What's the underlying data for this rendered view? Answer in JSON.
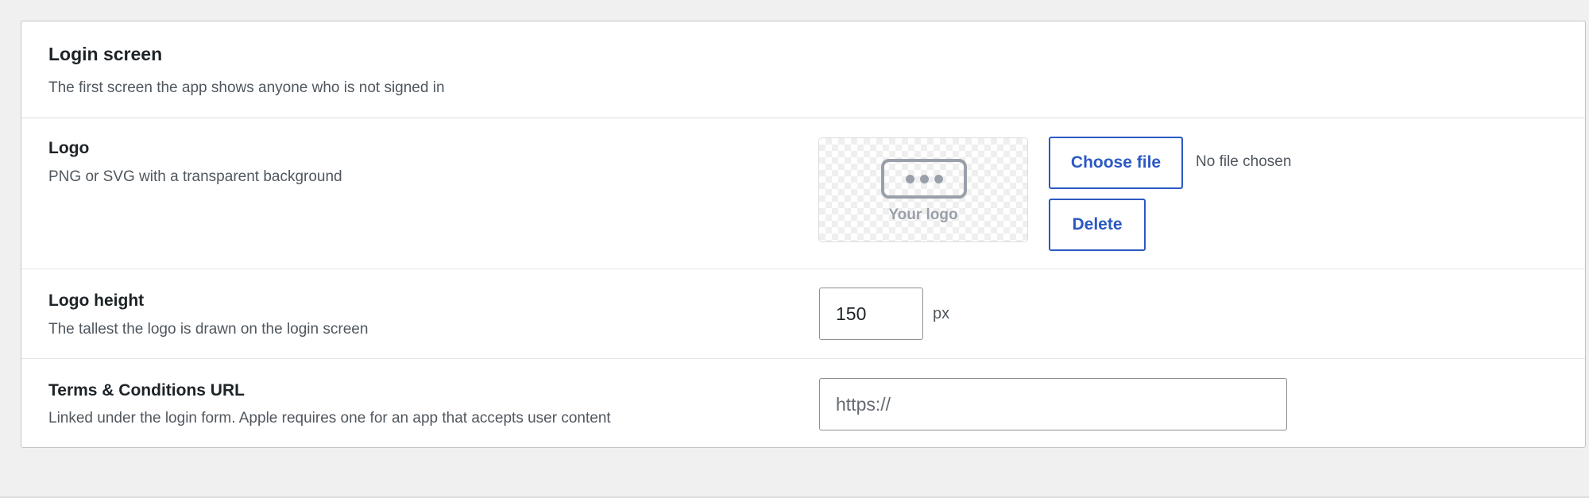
{
  "header": {
    "title": "Login screen",
    "description": "The first screen the app shows anyone who is not signed in"
  },
  "logo": {
    "title": "Logo",
    "description": "PNG or SVG with a transparent background",
    "preview_caption": "Your logo",
    "choose_button": "Choose file",
    "file_status": "No file chosen",
    "delete_button": "Delete"
  },
  "logo_height": {
    "title": "Logo height",
    "description": "The tallest the logo is drawn on the login screen",
    "value": "150",
    "unit": "px"
  },
  "terms": {
    "title": "Terms & Conditions URL",
    "description": "Linked under the login form. Apple requires one for an app that accepts user content",
    "placeholder": "https://"
  },
  "colors": {
    "accent": "#2b59c3",
    "page_background": "#f0f0f1"
  }
}
